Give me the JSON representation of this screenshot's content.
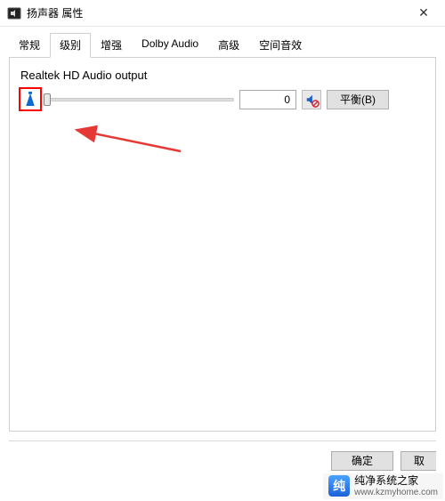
{
  "window": {
    "title": "扬声器 属性",
    "close_label": "✕"
  },
  "tabs": [
    {
      "label": "常规",
      "active": false
    },
    {
      "label": "级别",
      "active": true
    },
    {
      "label": "增强",
      "active": false
    },
    {
      "label": "Dolby Audio",
      "active": false
    },
    {
      "label": "高级",
      "active": false
    },
    {
      "label": "空间音效",
      "active": false
    }
  ],
  "level_panel": {
    "device_label": "Realtek HD Audio output",
    "slider_value": "0",
    "slider_percent": 0,
    "balance_label": "平衡(B)",
    "muted": true
  },
  "icons": {
    "speaker_indicator": "speaker-icon",
    "mute_button": "mute-icon",
    "app": "speaker-app-icon"
  },
  "annotations": {
    "arrow_color": "#e53935",
    "highlight_color": "#ff0000"
  },
  "buttons": {
    "ok": "确定",
    "cancel": "取"
  },
  "watermark": {
    "name": "纯净系统之家",
    "url": "www.kzmyhome.com"
  }
}
